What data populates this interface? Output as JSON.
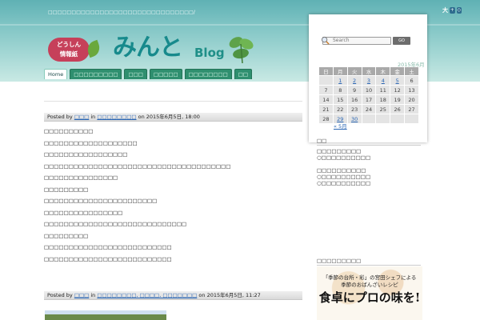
{
  "header": {
    "tagline": "□□□□□□□□□□□□□□□□□□□□□□□□□□□□□□□/",
    "font_size_label": "大",
    "font_size_icons": [
      "plus-icon",
      "reset-icon"
    ],
    "logo": {
      "badge_line1": "どうしん",
      "badge_line2": "情報紙",
      "title": "みんと",
      "blog": "Blog"
    }
  },
  "nav": {
    "tabs": [
      {
        "label": "Home",
        "active": true
      },
      {
        "label": "□□□□□□□□□"
      },
      {
        "label": "□□□"
      },
      {
        "label": "□□□□□"
      },
      {
        "label": "□□□□□□□□"
      },
      {
        "label": "□□"
      }
    ]
  },
  "search": {
    "placeholder": "Search",
    "button": "GO"
  },
  "calendar": {
    "caption": "2015年6月",
    "weekdays": [
      "日",
      "月",
      "火",
      "水",
      "木",
      "金",
      "土"
    ],
    "rows": [
      [
        {
          "d": ""
        },
        {
          "d": "1",
          "link": true
        },
        {
          "d": "2",
          "link": true
        },
        {
          "d": "3",
          "link": true
        },
        {
          "d": "4",
          "link": true
        },
        {
          "d": "5",
          "link": true
        },
        {
          "d": "6"
        }
      ],
      [
        {
          "d": "7"
        },
        {
          "d": "8"
        },
        {
          "d": "9"
        },
        {
          "d": "10"
        },
        {
          "d": "11"
        },
        {
          "d": "12"
        },
        {
          "d": "13"
        }
      ],
      [
        {
          "d": "14"
        },
        {
          "d": "15"
        },
        {
          "d": "16"
        },
        {
          "d": "17"
        },
        {
          "d": "18"
        },
        {
          "d": "19"
        },
        {
          "d": "20"
        }
      ],
      [
        {
          "d": "21"
        },
        {
          "d": "22"
        },
        {
          "d": "23"
        },
        {
          "d": "24"
        },
        {
          "d": "25"
        },
        {
          "d": "26"
        },
        {
          "d": "27"
        }
      ],
      [
        {
          "d": "28"
        },
        {
          "d": "29",
          "link": true
        },
        {
          "d": "30",
          "link": true
        },
        {
          "d": ""
        },
        {
          "d": ""
        },
        {
          "d": ""
        },
        {
          "d": ""
        }
      ]
    ],
    "prev": "« 5月"
  },
  "posts": [
    {
      "posted_by": "Posted by",
      "author": "□□□",
      "in": "in",
      "categories": "□□□□□□□□",
      "on": "on 2015年6月5日, 18:00",
      "lines": [
        "□□□□□□□□□□",
        "□□□□□□□□□□□□□□□□□□□",
        "□□□□□□□□□□□□□□□□□",
        "□□□□□□□□□□□□□□□□□□□□□□□□□□□□□□□□□□□□□□",
        "□□□□□□□□□□□□□□□",
        "□□□□□□□□□",
        "□□□□□□□□□□□□□□□□□□□□□□□",
        "□□□□□□□□□□□□□□□□",
        "□□□□□□□□□□□□□□□□□□□□□□□□□□□□□",
        "□□□□□□□□□",
        "□□□□□□□□□□□□□□□□□□□□□□□□□□",
        "□□□□□□□□□□□□□□□□□□□□□□□□□□"
      ]
    },
    {
      "posted_by": "Posted by",
      "author": "□□□",
      "in": "in",
      "categories": "□□□□□□□□, □□□□, □□□□□□□",
      "on": "on 2015年6月5日, 11:27"
    }
  ],
  "sidebar": {
    "heading1": "□□",
    "group1": [
      "□□□□□□□□□",
      "○□□□□□□□□□□"
    ],
    "group2": [
      "□□□□□□□□□□",
      "○□□□□□□□□□□",
      "○□□□□□□□□□□"
    ],
    "heading2": "□□□□□□□□□",
    "banner": {
      "line1": "「季節の台所・彩」の宮田シェフによる",
      "line2": "季節のおばんざいレシピ",
      "line3": "食卓にプロの味を!"
    }
  }
}
